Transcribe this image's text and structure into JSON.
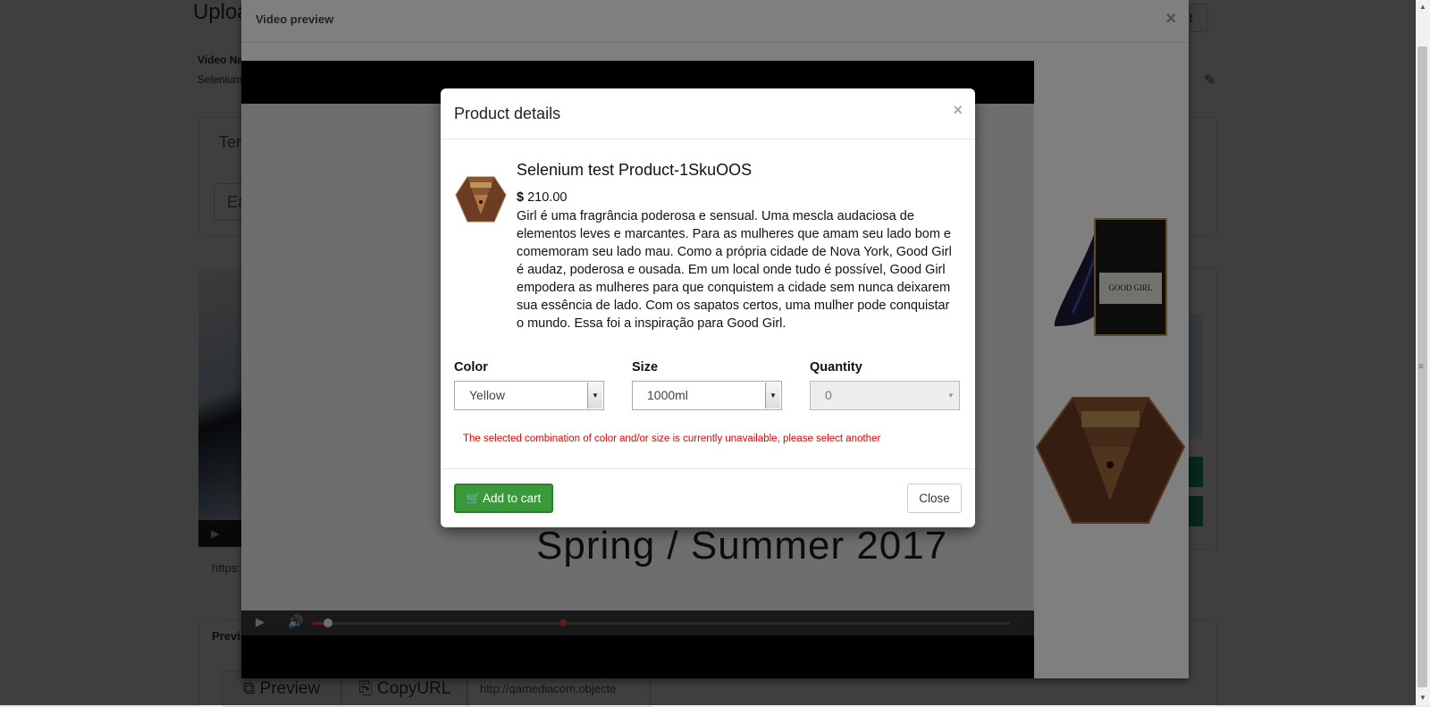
{
  "background": {
    "page_title": "Uploa",
    "snippet_button": "ppet",
    "video_name_label": "Video Na",
    "video_name_value": "Selenium",
    "tab_label": "Ter",
    "input_value": "Ea",
    "url_text": "https:",
    "preview_section_label": "Previ",
    "preview_button": "Preview",
    "copyurl_button": "CopyURL",
    "url_box": "http://qamediacom.objecte",
    "pencil_icon": "pencil-icon"
  },
  "video_preview": {
    "title": "Video preview",
    "close": "×",
    "headline": "Spring / Summer 2017"
  },
  "product_modal": {
    "title": "Product details",
    "close_x": "×",
    "product_name": "Selenium test Product-1SkuOOS",
    "currency": "$",
    "price": "210.00",
    "description": "Girl é uma fragrância poderosa e sensual. Uma mescla audaciosa de elementos leves e marcantes. Para as mulheres que amam seu lado bom e comemoram seu lado mau. Como a própria cidade de Nova York, Good Girl é audaz, poderosa e ousada. Em um local onde tudo é possível, Good Girl empodera as mulheres para que conquistem a cidade sem nunca deixarem sua essência de lado. Com os sapatos certos, uma mulher pode conquistar o mundo. Essa foi a inspiração para Good Girl.",
    "color_label": "Color",
    "color_value": "Yellow",
    "size_label": "Size",
    "size_value": "1000ml",
    "quantity_label": "Quantity",
    "quantity_value": "0",
    "error_message": "The selected combination of color and/or size is currently unavailable, please select another",
    "add_to_cart": "Add to cart",
    "close_button": "Close"
  },
  "colors": {
    "add_to_cart_bg": "#3a9a3a",
    "error_text": "#e60000",
    "overlay": "rgba(0,0,0,0.5)"
  }
}
